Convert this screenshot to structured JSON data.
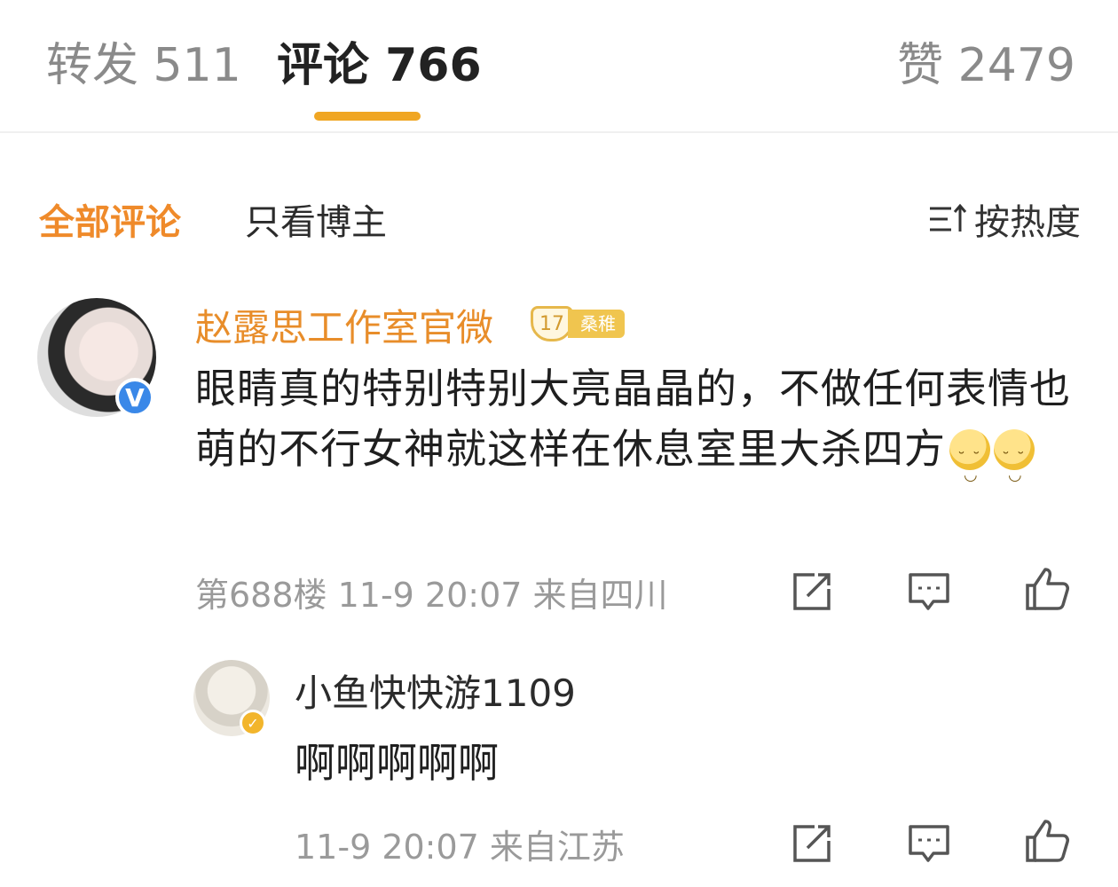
{
  "tabs": {
    "repost": "转发 511",
    "comments": "评论 766",
    "likes": "赞 2479"
  },
  "filters": {
    "all": "全部评论",
    "blogger_only": "只看博主",
    "sort": "按热度"
  },
  "comment": {
    "username": "赵露思工作室官微",
    "level": "17",
    "level_tag": "桑稚",
    "text": "眼睛真的特别特别大亮晶晶的，不做任何表情也萌的不行女神就这样在休息室里大杀四方",
    "meta": "第688楼 11-9 20:07 来自四川",
    "verified_mark": "V"
  },
  "reply": {
    "username": "小鱼快快游1109",
    "text": "啊啊啊啊啊",
    "meta": "11-9 20:07 来自江苏"
  },
  "colors": {
    "accent_orange": "#ef8a2a",
    "indicator": "#f0a623",
    "verified_blue": "#3a88e8",
    "gray_text": "#9a9a9a"
  },
  "icons": {
    "sort": "sort-icon",
    "share": "share-icon",
    "comment": "comment-icon",
    "like": "thumbs-up-icon"
  }
}
